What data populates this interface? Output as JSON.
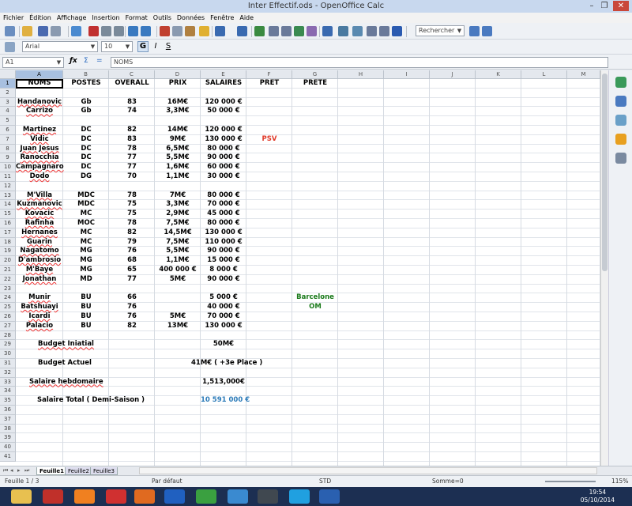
{
  "window": {
    "title": "Inter Effectif.ods - OpenOffice Calc"
  },
  "menu": [
    "Fichier",
    "Édition",
    "Affichage",
    "Insertion",
    "Format",
    "Outils",
    "Données",
    "Fenêtre",
    "Aide"
  ],
  "toolbar": {
    "search_placeholder": "Rechercher",
    "font_name": "Arial",
    "font_size": "10"
  },
  "formula_bar": {
    "cell_ref": "A1",
    "content": "NOMS"
  },
  "columns": [
    "A",
    "B",
    "C",
    "D",
    "E",
    "F",
    "G",
    "H",
    "I",
    "J",
    "K",
    "L",
    "M"
  ],
  "rows": [
    "1",
    "2",
    "3",
    "4",
    "5",
    "6",
    "7",
    "8",
    "9",
    "10",
    "11",
    "12",
    "13",
    "14",
    "15",
    "16",
    "17",
    "18",
    "19",
    "20",
    "21",
    "22",
    "23",
    "24",
    "25",
    "26",
    "27",
    "28",
    "29",
    "30",
    "31",
    "32",
    "33",
    "34",
    "35",
    "36",
    "37",
    "38",
    "39",
    "40",
    "41"
  ],
  "sheet": {
    "headers": [
      "NOMS",
      "POSTES",
      "OVERALL",
      "PRIX",
      "SALAIRES",
      "PRET",
      "PRETE"
    ],
    "players": [
      {
        "row": 3,
        "name": "Handanovic",
        "pos": "Gb",
        "ovr": "83",
        "prix": "16M€",
        "sal": "120 000 €"
      },
      {
        "row": 4,
        "name": "Carrizo",
        "pos": "Gb",
        "ovr": "74",
        "prix": "3,3M€",
        "sal": "50 000 €"
      },
      {
        "row": 6,
        "name": "Martinez",
        "pos": "DC",
        "ovr": "82",
        "prix": "14M€",
        "sal": "120 000 €"
      },
      {
        "row": 7,
        "name": "Vidic",
        "pos": "DC",
        "ovr": "83",
        "prix": "9M€",
        "sal": "130 000 €",
        "pret": "PSV"
      },
      {
        "row": 8,
        "name": "Juan Jesus",
        "pos": "DC",
        "ovr": "78",
        "prix": "6,5M€",
        "sal": "80 000 €"
      },
      {
        "row": 9,
        "name": "Ranocchia",
        "pos": "DC",
        "ovr": "77",
        "prix": "5,5M€",
        "sal": "90 000 €"
      },
      {
        "row": 10,
        "name": "Campagnaro",
        "pos": "DC",
        "ovr": "77",
        "prix": "1,6M€",
        "sal": "60 000 €"
      },
      {
        "row": 11,
        "name": "Dodo",
        "pos": "DG",
        "ovr": "70",
        "prix": "1,1M€",
        "sal": "30 000 €"
      },
      {
        "row": 13,
        "name": "M'Villa",
        "pos": "MDC",
        "ovr": "78",
        "prix": "7M€",
        "sal": "80 000 €"
      },
      {
        "row": 14,
        "name": "Kuzmanovic",
        "pos": "MDC",
        "ovr": "75",
        "prix": "3,3M€",
        "sal": "70 000 €"
      },
      {
        "row": 15,
        "name": "Kovacic",
        "pos": "MC",
        "ovr": "75",
        "prix": "2,9M€",
        "sal": "45 000 €"
      },
      {
        "row": 16,
        "name": "Rafinha",
        "pos": "MOC",
        "ovr": "78",
        "prix": "7,5M€",
        "sal": "80 000 €"
      },
      {
        "row": 17,
        "name": "Hernanes",
        "pos": "MC",
        "ovr": "82",
        "prix": "14,5M€",
        "sal": "130 000 €"
      },
      {
        "row": 18,
        "name": "Guarin",
        "pos": "MC",
        "ovr": "79",
        "prix": "7,5M€",
        "sal": "110 000 €"
      },
      {
        "row": 19,
        "name": "Nagatomo",
        "pos": "MG",
        "ovr": "76",
        "prix": "5,5M€",
        "sal": "90 000 €"
      },
      {
        "row": 20,
        "name": "D'ambrosio",
        "pos": "MG",
        "ovr": "68",
        "prix": "1,1M€",
        "sal": "15 000 €"
      },
      {
        "row": 21,
        "name": "M'Baye",
        "pos": "MG",
        "ovr": "65",
        "prix": "400 000 €",
        "sal": "8 000 €"
      },
      {
        "row": 22,
        "name": "Jonathan",
        "pos": "MD",
        "ovr": "77",
        "prix": "5M€",
        "sal": "90 000 €"
      },
      {
        "row": 24,
        "name": "Munir",
        "pos": "BU",
        "ovr": "66",
        "prix": "",
        "sal": "5 000 €",
        "prete": "Barcelone"
      },
      {
        "row": 25,
        "name": "Batshuayi",
        "pos": "BU",
        "ovr": "76",
        "prix": "",
        "sal": "40 000 €",
        "prete": "OM"
      },
      {
        "row": 26,
        "name": "Icardi",
        "pos": "BU",
        "ovr": "76",
        "prix": "5M€",
        "sal": "70 000 €"
      },
      {
        "row": 27,
        "name": "Palacio",
        "pos": "BU",
        "ovr": "82",
        "prix": "13M€",
        "sal": "130 000 €"
      }
    ],
    "summary": {
      "budget_initial_label": "Budget Iniatial",
      "budget_initial_value": "50M€",
      "budget_actuel_label": "Budget Actuel",
      "budget_actuel_value": "41M€ ( +3e Place )",
      "hebdo_label": "Salaire hebdomaire",
      "hebdo_value": "1,513,000€",
      "total_label": "Salaire Total ( Demi-Saison )",
      "total_value": "10 591 000 €"
    }
  },
  "tabs": [
    "Feuille1",
    "Feuille2",
    "Feuille3"
  ],
  "status": {
    "sheet": "Feuille 1 / 3",
    "style": "Par défaut",
    "mode": "STD",
    "sum": "Somme=0",
    "zoom": "115%"
  },
  "clock": {
    "time": "19:54",
    "date": "05/10/2014"
  },
  "colors": {
    "red": "#e03a2a",
    "green": "#1a7a1a",
    "blue": "#2a7ab8"
  }
}
